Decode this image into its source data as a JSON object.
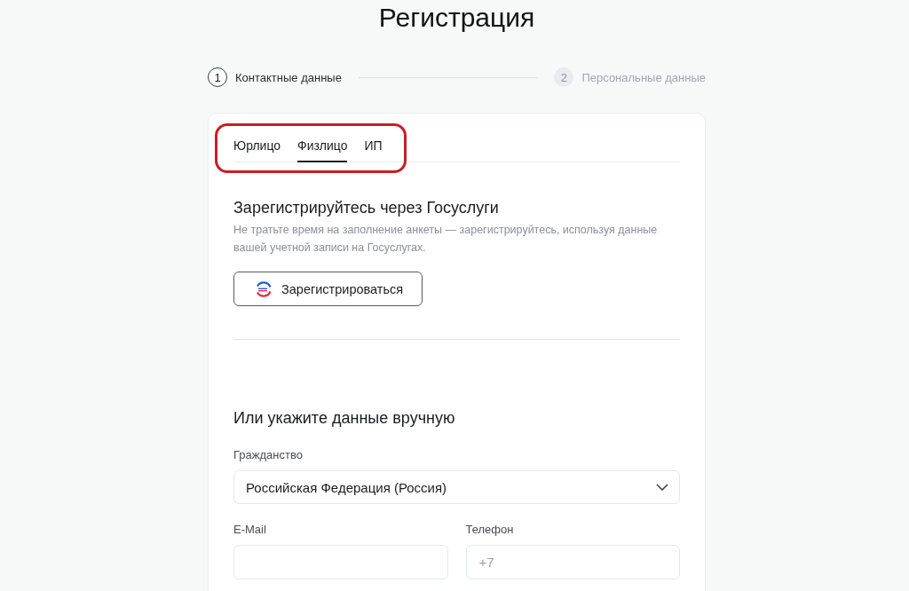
{
  "title": "Регистрация",
  "steps": [
    {
      "number": "1",
      "label": "Контактные данные",
      "selected": true
    },
    {
      "number": "2",
      "label": "Персональные данные",
      "selected": false
    }
  ],
  "tabs": [
    {
      "label": "Юрлицо",
      "selected": false
    },
    {
      "label": "Физлицо",
      "selected": true
    },
    {
      "label": "ИП",
      "selected": false
    }
  ],
  "tabs_highlighted": true,
  "gosuslugi": {
    "heading": "Зарегистрируйтесь через Госуслуги",
    "description": "Не тратьте время на заполнение анкеты — зарегистрируйтесь, используя данные вашей учетной записи на Госуслугах.",
    "button": "Зарегистрироваться"
  },
  "manual": {
    "heading": "Или укажите данные вручную",
    "fields": [
      {
        "kind": "select",
        "label": "Гражданство",
        "value": "Российская Федерация (Россия)"
      },
      {
        "kind": "input",
        "label": "E-Mail"
      },
      {
        "kind": "input",
        "label": "Телефон",
        "placeholder": "+7"
      }
    ]
  }
}
